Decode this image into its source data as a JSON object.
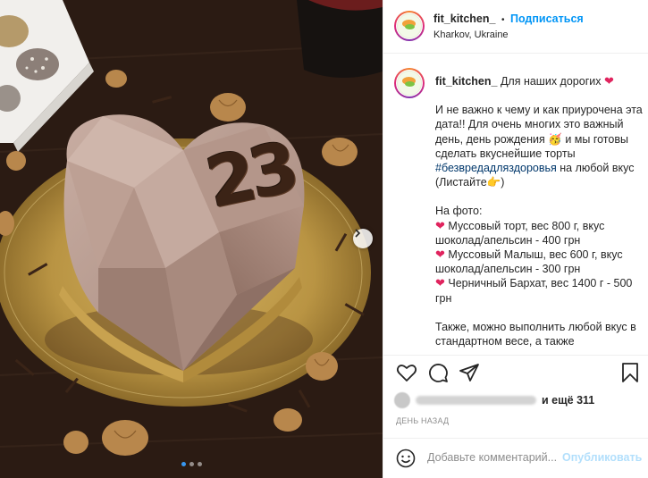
{
  "post": {
    "username": "fit_kitchen_",
    "separator": "•",
    "follow_label": "Подписаться",
    "location": "Kharkov, Ukraine",
    "avatar_text": "fit_kitchen"
  },
  "photo": {
    "cake_number": "23",
    "slides": 3,
    "active_slide": 1
  },
  "caption": {
    "username": "fit_kitchen_",
    "line1": "Для наших дорогих",
    "heart": "❤",
    "p1_a": "И не важно к чему и как приурочена эта дата!! Для очень многих это важный день, день рождения",
    "p1_emoji": "🥳",
    "p1_b": "и мы готовы сделать вкуснейшие торты",
    "hashtag": "#безвредадляздоровья",
    "p1_c": "на любой вкус (Листайте",
    "p1_point": "👉",
    "p1_end": ")",
    "photo_header": "На фото:",
    "item1": "Муссовый торт, вес 800 г, вкус шоколад/апельсин - 400 грн",
    "item2": "Муссовый Малыш, вес 600 г, вкус шоколад/апельсин - 300 грн",
    "item3": "Черничный Бархат, вес 1400 г - 500 грн",
    "p3": "Также, можно выполнить любой вкус в стандартном весе, а также"
  },
  "likes": {
    "and_more": "и ещё 311"
  },
  "timestamp": "ДЕНЬ НАЗАД",
  "comment": {
    "placeholder": "Добавьте комментарий...",
    "post_label": "Опубликовать"
  },
  "colors": {
    "link": "#0095f6",
    "hashtag": "#00376b",
    "post_disabled": "#b2dffc",
    "heart": "#e0245e",
    "slide_dot_active": "#3897f0"
  }
}
